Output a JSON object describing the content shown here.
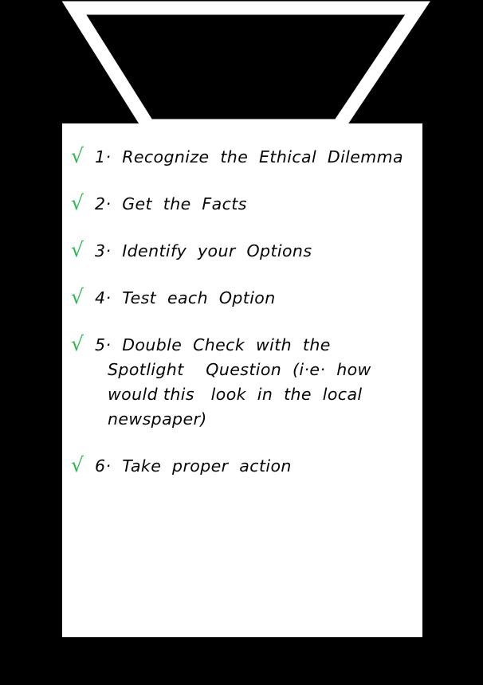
{
  "colors": {
    "background": "#000000",
    "card": "#ffffff",
    "graphic_outline": "#ffffff",
    "check_mark": "#2eb84f",
    "text": "#050505"
  },
  "graphic": {
    "name": "funnel-outline",
    "shape": "inverted-trapezoid"
  },
  "checklist": {
    "check_glyph": "√",
    "items": [
      {
        "number": "1·",
        "lines": [
          "1·  Recognize  the  Ethical  Dilemma"
        ]
      },
      {
        "number": "2·",
        "lines": [
          "2·  Get  the  Facts"
        ]
      },
      {
        "number": "3·",
        "lines": [
          "3·  Identify  your  Options"
        ]
      },
      {
        "number": "4·",
        "lines": [
          "4·  Test  each  Option"
        ]
      },
      {
        "number": "5·",
        "lines": [
          "5·  Double  Check  with  the",
          "Spotlight    Question  (i·e·  how",
          "would this   look  in  the  local",
          "newspaper)"
        ]
      },
      {
        "number": "6·",
        "lines": [
          "6·  Take  proper  action"
        ]
      }
    ]
  }
}
